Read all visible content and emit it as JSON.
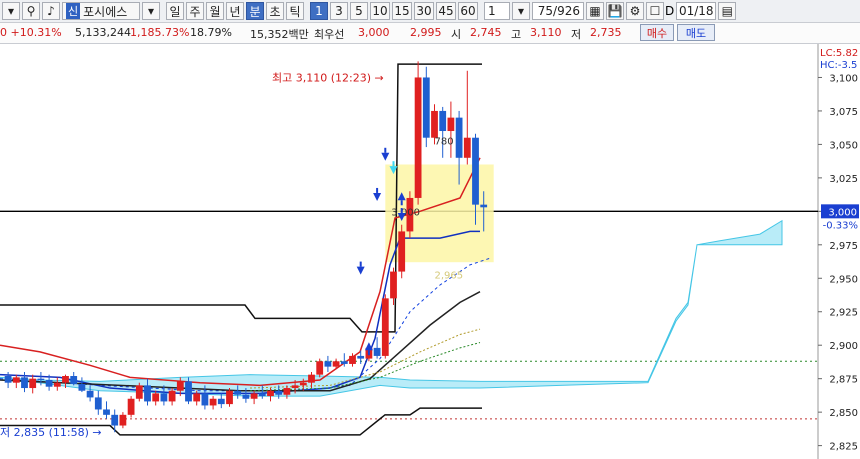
{
  "toolbar": {
    "search_icon": "search-icon",
    "sound_icon": "speaker-icon",
    "badge": "신",
    "stock_name": "포시에스",
    "period_buttons": [
      "일",
      "주",
      "월",
      "년",
      "분",
      "초",
      "틱"
    ],
    "active_period": "분",
    "interval_buttons": [
      "1",
      "3",
      "5",
      "10",
      "15",
      "30",
      "45",
      "60"
    ],
    "active_interval": "1",
    "interval_value": "1",
    "count_value": "75/926",
    "checkbox_label": "D",
    "date_value": "01/18",
    "grid_icon": "grid-icon",
    "save_icon": "save-icon",
    "settings_icon": "gear-icon",
    "calendar_icon": "calendar-icon"
  },
  "info": {
    "change": "0 +10.31%",
    "volume": "5,133,244",
    "vol_ratio": "1,185.73%",
    "turnover": "18.79%",
    "amount": "15,352백만",
    "best_label": "최우선",
    "best_ask": "3,000",
    "best_bid": "2,995",
    "open_label": "시",
    "open": "2,745",
    "high_label": "고",
    "high": "3,110",
    "low_label": "저",
    "low": "2,735",
    "buy_label": "매수",
    "sell_label": "매도"
  },
  "chart_data": {
    "type": "candlestick",
    "y_ticks": [
      3100,
      3075,
      3050,
      3025,
      3000,
      2975,
      2950,
      2925,
      2900,
      2875,
      2850,
      2825
    ],
    "y_tick_labels": [
      "3,100",
      "3,075",
      "3,050",
      "3,025",
      "3,000",
      "2,975",
      "2,950",
      "2,925",
      "2,900",
      "2,875",
      "2,850",
      "2,825"
    ],
    "ylim": [
      2815,
      3125
    ],
    "current_price_label": "3,000",
    "current_change_label": "-0.33%",
    "lc_label": "LC:5.82",
    "hc_label": "HC:-3.5",
    "high_annotation": "최고 3,110 (12:23)",
    "low_annotation": "저 2,835 (11:58)",
    "box_label": "3,000",
    "box_bottom_label": "2,965",
    "box_right_label": "780",
    "candles": [
      {
        "o": 2877,
        "h": 2880,
        "l": 2868,
        "c": 2872
      },
      {
        "o": 2872,
        "h": 2878,
        "l": 2868,
        "c": 2876
      },
      {
        "o": 2876,
        "h": 2880,
        "l": 2865,
        "c": 2868
      },
      {
        "o": 2868,
        "h": 2878,
        "l": 2864,
        "c": 2875
      },
      {
        "o": 2875,
        "h": 2880,
        "l": 2870,
        "c": 2874
      },
      {
        "o": 2874,
        "h": 2878,
        "l": 2866,
        "c": 2869
      },
      {
        "o": 2869,
        "h": 2876,
        "l": 2866,
        "c": 2872
      },
      {
        "o": 2872,
        "h": 2878,
        "l": 2868,
        "c": 2877
      },
      {
        "o": 2877,
        "h": 2880,
        "l": 2870,
        "c": 2871
      },
      {
        "o": 2871,
        "h": 2876,
        "l": 2865,
        "c": 2866
      },
      {
        "o": 2866,
        "h": 2870,
        "l": 2858,
        "c": 2861
      },
      {
        "o": 2861,
        "h": 2866,
        "l": 2848,
        "c": 2852
      },
      {
        "o": 2852,
        "h": 2858,
        "l": 2845,
        "c": 2848
      },
      {
        "o": 2848,
        "h": 2852,
        "l": 2835,
        "c": 2840
      },
      {
        "o": 2840,
        "h": 2850,
        "l": 2838,
        "c": 2848
      },
      {
        "o": 2848,
        "h": 2862,
        "l": 2846,
        "c": 2860
      },
      {
        "o": 2860,
        "h": 2872,
        "l": 2858,
        "c": 2870
      },
      {
        "o": 2870,
        "h": 2875,
        "l": 2855,
        "c": 2858
      },
      {
        "o": 2858,
        "h": 2866,
        "l": 2855,
        "c": 2864
      },
      {
        "o": 2864,
        "h": 2870,
        "l": 2855,
        "c": 2858
      },
      {
        "o": 2858,
        "h": 2868,
        "l": 2855,
        "c": 2866
      },
      {
        "o": 2866,
        "h": 2876,
        "l": 2862,
        "c": 2873
      },
      {
        "o": 2873,
        "h": 2876,
        "l": 2856,
        "c": 2858
      },
      {
        "o": 2858,
        "h": 2866,
        "l": 2855,
        "c": 2864
      },
      {
        "o": 2864,
        "h": 2870,
        "l": 2852,
        "c": 2855
      },
      {
        "o": 2855,
        "h": 2862,
        "l": 2852,
        "c": 2860
      },
      {
        "o": 2860,
        "h": 2864,
        "l": 2853,
        "c": 2856
      },
      {
        "o": 2856,
        "h": 2868,
        "l": 2854,
        "c": 2866
      },
      {
        "o": 2866,
        "h": 2870,
        "l": 2860,
        "c": 2863
      },
      {
        "o": 2863,
        "h": 2868,
        "l": 2857,
        "c": 2860
      },
      {
        "o": 2860,
        "h": 2866,
        "l": 2856,
        "c": 2864
      },
      {
        "o": 2864,
        "h": 2870,
        "l": 2860,
        "c": 2862
      },
      {
        "o": 2862,
        "h": 2868,
        "l": 2858,
        "c": 2866
      },
      {
        "o": 2866,
        "h": 2870,
        "l": 2860,
        "c": 2863
      },
      {
        "o": 2863,
        "h": 2870,
        "l": 2860,
        "c": 2868
      },
      {
        "o": 2868,
        "h": 2874,
        "l": 2864,
        "c": 2870
      },
      {
        "o": 2870,
        "h": 2875,
        "l": 2866,
        "c": 2872
      },
      {
        "o": 2872,
        "h": 2880,
        "l": 2868,
        "c": 2878
      },
      {
        "o": 2878,
        "h": 2890,
        "l": 2876,
        "c": 2888
      },
      {
        "o": 2888,
        "h": 2892,
        "l": 2880,
        "c": 2884
      },
      {
        "o": 2884,
        "h": 2890,
        "l": 2882,
        "c": 2888
      },
      {
        "o": 2888,
        "h": 2894,
        "l": 2884,
        "c": 2886
      },
      {
        "o": 2886,
        "h": 2894,
        "l": 2884,
        "c": 2892
      },
      {
        "o": 2892,
        "h": 2896,
        "l": 2886,
        "c": 2890
      },
      {
        "o": 2890,
        "h": 2900,
        "l": 2888,
        "c": 2898
      },
      {
        "o": 2898,
        "h": 2906,
        "l": 2890,
        "c": 2892
      },
      {
        "o": 2892,
        "h": 2938,
        "l": 2890,
        "c": 2935
      },
      {
        "o": 2935,
        "h": 2958,
        "l": 2930,
        "c": 2955
      },
      {
        "o": 2955,
        "h": 2990,
        "l": 2950,
        "c": 2985
      },
      {
        "o": 2985,
        "h": 3015,
        "l": 2980,
        "c": 3010
      },
      {
        "o": 3010,
        "h": 3112,
        "l": 3005,
        "c": 3100
      },
      {
        "o": 3100,
        "h": 3108,
        "l": 3048,
        "c": 3055
      },
      {
        "o": 3055,
        "h": 3080,
        "l": 3050,
        "c": 3075
      },
      {
        "o": 3075,
        "h": 3078,
        "l": 3040,
        "c": 3060
      },
      {
        "o": 3060,
        "h": 3082,
        "l": 3040,
        "c": 3070
      },
      {
        "o": 3070,
        "h": 3075,
        "l": 3020,
        "c": 3040
      },
      {
        "o": 3040,
        "h": 3105,
        "l": 3035,
        "c": 3055
      },
      {
        "o": 3055,
        "h": 3058,
        "l": 2990,
        "c": 3005
      },
      {
        "o": 3005,
        "h": 3015,
        "l": 2985,
        "c": 3003
      }
    ]
  }
}
